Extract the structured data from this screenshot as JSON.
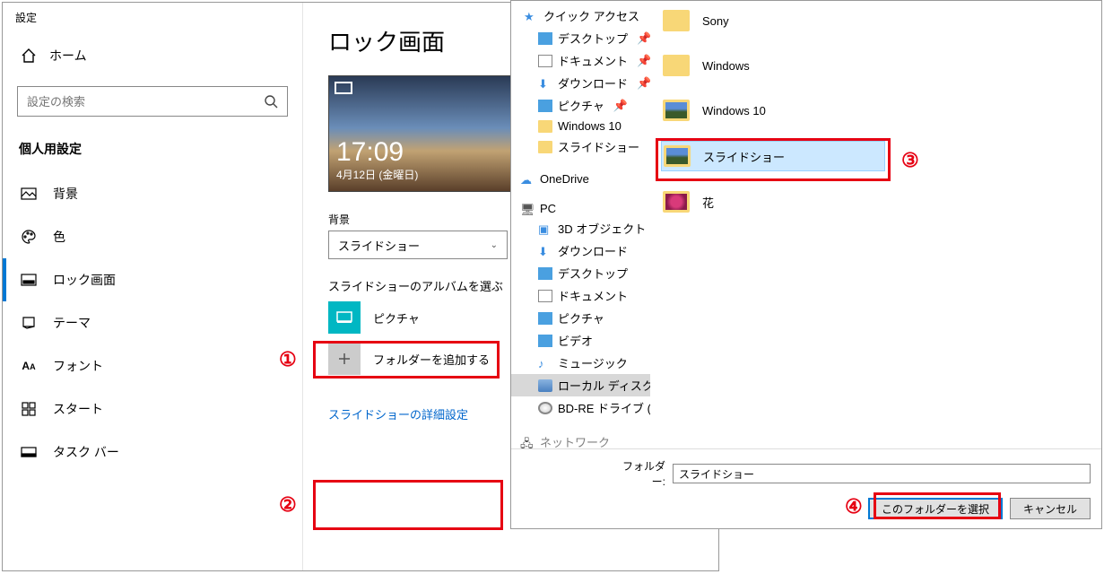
{
  "settings": {
    "window_title": "設定",
    "home": "ホーム",
    "search_placeholder": "設定の検索",
    "section": "個人用設定",
    "nav": {
      "background": "背景",
      "color": "色",
      "lock": "ロック画面",
      "theme": "テーマ",
      "font": "フォント",
      "start": "スタート",
      "taskbar": "タスク バー"
    }
  },
  "content": {
    "title": "ロック画面",
    "preview_time": "17:09",
    "preview_date": "4月12日 (金曜日)",
    "bg_label": "背景",
    "bg_value": "スライドショー",
    "album_label": "スライドショーのアルバムを選ぶ",
    "album_pictures": "ピクチャ",
    "album_add": "フォルダーを追加する",
    "advanced_link": "スライドショーの詳細設定"
  },
  "dialog": {
    "nav": {
      "quick": "クイック アクセス",
      "desktop": "デスクトップ",
      "documents": "ドキュメント",
      "downloads": "ダウンロード",
      "pictures": "ピクチャ",
      "win10": "Windows 10",
      "slideshow": "スライドショー",
      "onedrive": "OneDrive",
      "pc": "PC",
      "obj3d": "3D オブジェクト",
      "downloads2": "ダウンロード",
      "desktop2": "デスクトップ",
      "documents2": "ドキュメント",
      "pictures2": "ピクチャ",
      "video": "ビデオ",
      "music": "ミュージック",
      "localdisk": "ローカル ディスク (C",
      "bdre": "BD-RE ドライブ (D",
      "network": "ネットワーク"
    },
    "folders": {
      "sony": "Sony",
      "windows": "Windows",
      "win10": "Windows 10",
      "slideshow": "スライドショー",
      "flower": "花"
    },
    "folder_label": "フォルダー:",
    "folder_value": "スライドショー",
    "btn_select": "このフォルダーを選択",
    "btn_cancel": "キャンセル"
  },
  "callouts": {
    "n1": "①",
    "n2": "②",
    "n3": "③",
    "n4": "④"
  }
}
